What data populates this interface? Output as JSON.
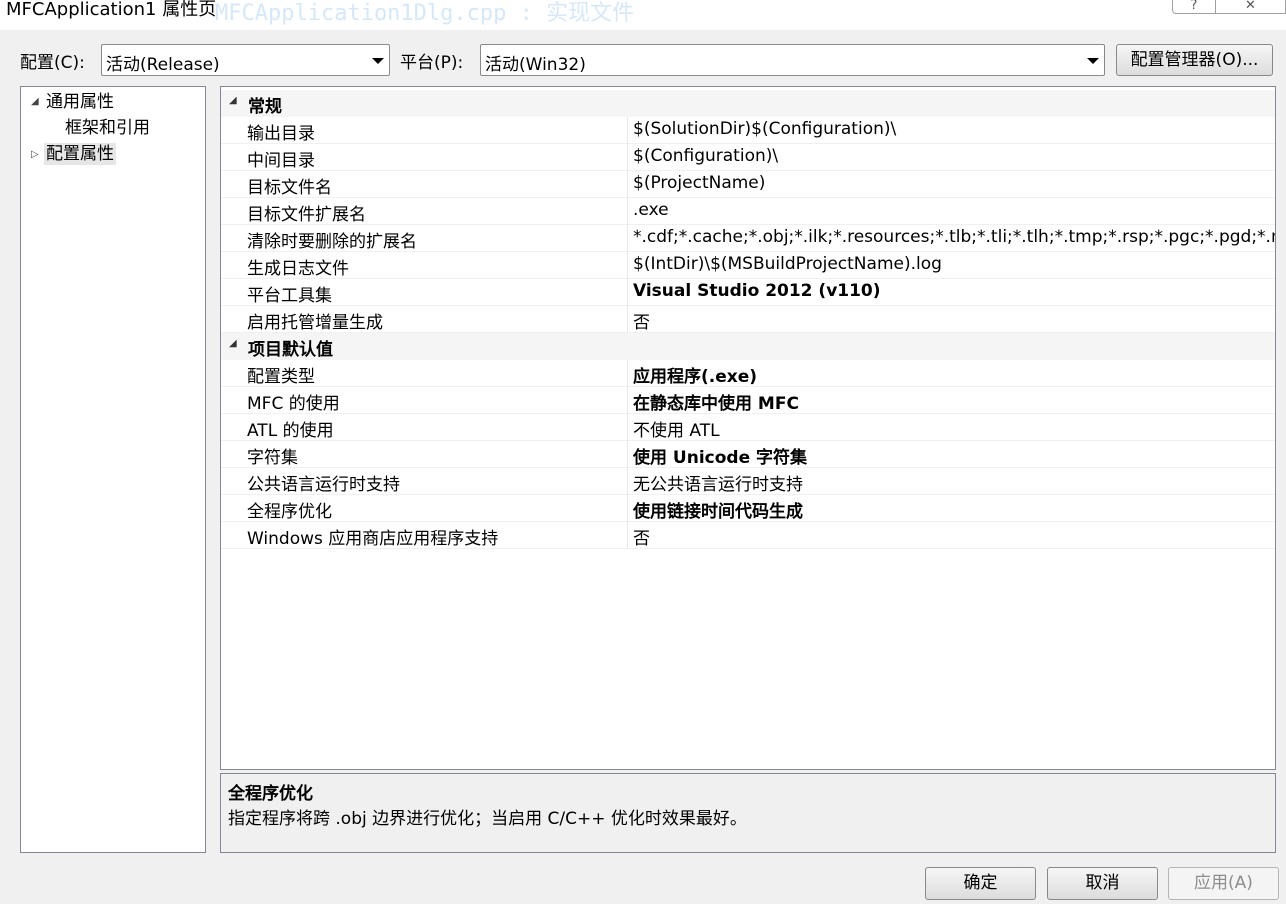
{
  "window": {
    "title": "MFCApplication1 属性页",
    "ghost_title": "MFCApplication1Dlg.cpp : 实现文件",
    "help_glyph": "?",
    "close_glyph": "✕"
  },
  "config_row": {
    "config_label": "配置(C):",
    "config_value": "活动(Release)",
    "platform_label": "平台(P):",
    "platform_value": "活动(Win32)",
    "config_manager_label": "配置管理器(O)..."
  },
  "tree": {
    "items": [
      {
        "label": "通用属性",
        "expander": "◢"
      },
      {
        "label": "框架和引用"
      },
      {
        "label": "配置属性",
        "expander": "▷"
      }
    ]
  },
  "grid": {
    "categories": [
      {
        "label": "常规",
        "rows": [
          {
            "name": "输出目录",
            "value": "$(SolutionDir)$(Configuration)\\"
          },
          {
            "name": "中间目录",
            "value": "$(Configuration)\\"
          },
          {
            "name": "目标文件名",
            "value": "$(ProjectName)"
          },
          {
            "name": "目标文件扩展名",
            "value": ".exe"
          },
          {
            "name": "清除时要删除的扩展名",
            "value": "*.cdf;*.cache;*.obj;*.ilk;*.resources;*.tlb;*.tli;*.tlh;*.tmp;*.rsp;*.pgc;*.pgd;*.met"
          },
          {
            "name": "生成日志文件",
            "value": "$(IntDir)\\$(MSBuildProjectName).log"
          },
          {
            "name": "平台工具集",
            "value": "Visual Studio 2012 (v110)"
          },
          {
            "name": "启用托管增量生成",
            "value": "否"
          }
        ]
      },
      {
        "label": "项目默认值",
        "rows": [
          {
            "name": "配置类型",
            "value": "应用程序(.exe)"
          },
          {
            "name": "MFC 的使用",
            "value": "在静态库中使用 MFC"
          },
          {
            "name": "ATL 的使用",
            "value": "不使用 ATL"
          },
          {
            "name": "字符集",
            "value": "使用 Unicode 字符集"
          },
          {
            "name": "公共语言运行时支持",
            "value": "无公共语言运行时支持"
          },
          {
            "name": "全程序优化",
            "value": "使用链接时间代码生成"
          },
          {
            "name": "Windows 应用商店应用程序支持",
            "value": "否"
          }
        ]
      }
    ]
  },
  "description": {
    "title": "全程序优化",
    "text": "指定程序将跨 .obj 边界进行优化；当启用 C/C++ 优化时效果最好。"
  },
  "buttons": {
    "ok": "确定",
    "cancel": "取消",
    "apply": "应用(A)"
  }
}
